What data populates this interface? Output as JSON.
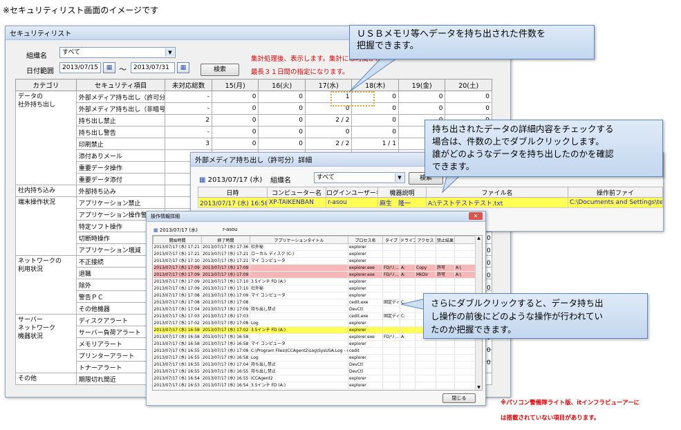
{
  "caption": "※セキュリティリスト画面のイメージです",
  "main_window": {
    "title": "セキュリティリスト",
    "org_label": "組織名",
    "org_value": "すべて",
    "date_label": "日付範囲",
    "date_from": "2013/07/15",
    "date_sep": "～",
    "date_to": "2013/07/31",
    "search_button": "検索",
    "notice_1": "集計処理後、表示します。集計には時間がかかります",
    "notice_2": "最長３１日間の指定になります。",
    "headers": [
      "カテゴリ",
      "セキュリティ項目",
      "未対応総数",
      "15(月)",
      "16(火)",
      "17(水)",
      "18(木)",
      "19(金)",
      "20(土)"
    ],
    "rows": [
      [
        "データの\n社外持ち出し",
        "外部メディア持ち出し（許可分）",
        "-",
        "0",
        "0",
        "1",
        "0",
        "0",
        "0"
      ],
      [
        "",
        "外部メディア持ち出し（非暗号）",
        "-",
        "0",
        "0",
        "0",
        "0",
        "0",
        "0"
      ],
      [
        "",
        "持ち出し禁止",
        "2",
        "0",
        "0",
        "2 / 2",
        "0",
        "0",
        "0"
      ],
      [
        "",
        "持ち出し警告",
        "-",
        "0",
        "0",
        "0",
        "0",
        "0",
        "0"
      ],
      [
        "",
        "印刷禁止",
        "3",
        "0",
        "0",
        "2 / 2",
        "1 / 1",
        "0",
        "0"
      ],
      [
        "",
        "添付ありメール",
        "-",
        "0",
        "1",
        "2",
        "2",
        "",
        ""
      ],
      [
        "",
        "重要データ操作",
        "",
        "",
        "",
        "",
        "",
        "",
        ""
      ],
      [
        "",
        "重要データ添付",
        "",
        "",
        "",
        "",
        "",
        "",
        ""
      ],
      [
        "社内持ち込み",
        "外部持ち込み",
        "",
        "",
        "",
        "",
        "",
        "",
        ""
      ],
      [
        "端末操作状況",
        "アプリケーション禁止",
        "",
        "",
        "",
        "",
        "",
        "",
        ""
      ],
      [
        "",
        "アプリケーション操作警告",
        "",
        "",
        "",
        "",
        "",
        "",
        ""
      ],
      [
        "",
        "特定ソフト操作",
        "",
        "",
        "",
        "",
        "",
        "",
        ""
      ],
      [
        "",
        "切断時操作",
        "",
        "",
        "",
        "",
        "",
        "",
        ""
      ],
      [
        "",
        "アプリケーション増減",
        "",
        "",
        "",
        "",
        "",
        "",
        ""
      ],
      [
        "ネットワークの\n利用状況",
        "不正接続",
        "",
        "",
        "",
        "",
        "",
        "",
        ""
      ],
      [
        "",
        "退職",
        "",
        "",
        "",
        "",
        "",
        "",
        ""
      ],
      [
        "",
        "除外",
        "",
        "",
        "",
        "",
        "",
        "",
        ""
      ],
      [
        "",
        "警告ＰＣ",
        "",
        "",
        "",
        "",
        "",
        "",
        ""
      ],
      [
        "",
        "その他機器",
        "",
        "",
        "",
        "",
        "",
        "",
        ""
      ],
      [
        "サーバー\nネットワーク\n機器状況",
        "ディスクアラート",
        "",
        "",
        "",
        "",
        "",
        "",
        ""
      ],
      [
        "",
        "サーバー負荷アラート",
        "",
        "",
        "",
        "",
        "",
        "",
        ""
      ],
      [
        "",
        "メモリアラート",
        "",
        "",
        "",
        "",
        "",
        "",
        ""
      ],
      [
        "",
        "プリンターアラート",
        "",
        "",
        "",
        "",
        "",
        "",
        ""
      ],
      [
        "",
        "トナーアラート",
        "",
        "",
        "",
        "",
        "",
        "",
        ""
      ],
      [
        "その他",
        "期限切れ間近",
        "",
        "",
        "",
        "",
        "",
        "",
        ""
      ]
    ],
    "right_stub_values": [
      "0",
      "0",
      "0",
      "0",
      "0",
      "0",
      "0",
      "0",
      "0",
      "0",
      "0",
      "0"
    ]
  },
  "detail_window": {
    "title": "外部メディア持ち出し（許可分）詳細",
    "date": "2013/07/17 (水)",
    "org_label": "組織名",
    "org_value": "すべて",
    "search_button": "検索",
    "headers": [
      "日時",
      "コンピューター名",
      "ログインユーザー名",
      "機器説明",
      "ファイル名",
      "操作前ファイ"
    ],
    "row": [
      "2013/07/17 (水) 16:58",
      "XP-TAIKENBAN",
      "r-asou",
      "麻生　隆一",
      "A:\\テストテストテスト.txt",
      "C:\\Documents and Settings\\test\\"
    ]
  },
  "log_window": {
    "title": "操作情報詳細",
    "date": "2013/07/17 (水)",
    "user": "r-asou",
    "headers": [
      "開始時間",
      "終了時間",
      "アプリケーションタイトル",
      "プロセス名",
      "タイプ",
      "ドライブ",
      "アクセス",
      "禁止結果",
      ""
    ],
    "rows": [
      [
        "2013/07/17 (水) 17:21",
        "2013/07/17 (水) 17:36",
        "社外秘",
        "explorer",
        "",
        "",
        "",
        "",
        ""
      ],
      [
        "2013/07/17 (水) 17:21",
        "2013/07/17 (水) 17:21",
        "ローカル ディスク (C:)",
        "explorer",
        "",
        "",
        "",
        "",
        ""
      ],
      [
        "2013/07/17 (水) 17:10",
        "2013/07/17 (水) 17:21",
        "マイ コンピュータ",
        "explorer",
        "",
        "",
        "",
        "",
        ""
      ],
      [
        "2013/07/17 (水) 17:09",
        "2013/07/17 (水) 17:09",
        "",
        "explorer.exe",
        "FD/リ...",
        "A:",
        "Copy",
        "許可",
        "A:\\"
      ],
      [
        "2013/07/17 (水) 17:09",
        "2013/07/17 (水) 17:09",
        "",
        "explorer.exe",
        "FD/リ...",
        "A:",
        "MkDir",
        "許可",
        "A:\\"
      ],
      [
        "2013/07/17 (水) 17:09",
        "2013/07/17 (水) 17:10",
        "3.5インチ FD (A:)",
        "explorer",
        "",
        "",
        "",
        "",
        ""
      ],
      [
        "2013/07/17 (水) 17:09",
        "2013/07/17 (水) 17:10",
        "社外秘",
        "explorer",
        "",
        "",
        "",
        "",
        ""
      ],
      [
        "2013/07/17 (水) 17:08",
        "2013/07/17 (水) 17:09",
        "マイ コンピュータ",
        "explorer",
        "",
        "",
        "",
        "",
        ""
      ],
      [
        "2013/07/17 (水) 17:08",
        "2013/07/17 (水) 17:08",
        "",
        "cedit.exe",
        "固定ディ...",
        "C:",
        "Write",
        "",
        "C:\\Doc"
      ],
      [
        "2013/07/17 (水) 17:04",
        "2013/07/17 (水) 17:09",
        "持ち出し禁止",
        "DevCtl",
        "",
        "",
        "",
        "",
        ""
      ],
      [
        "2013/07/17 (水) 17:03",
        "2013/07/17 (水) 17:03",
        "",
        "cedit.exe",
        "固定ディ...",
        "C:",
        "",
        "",
        ""
      ],
      [
        "2013/07/17 (水) 17:02",
        "2013/07/17 (水) 17:08",
        "Log",
        "explorer",
        "",
        "",
        "",
        "",
        ""
      ],
      [
        "2013/07/17 (水) 16:58",
        "2013/07/17 (水) 17:02",
        "3.5インチ FD (A:)",
        "explorer",
        "",
        "",
        "",
        "",
        ""
      ],
      [
        "2013/07/17 (水) 16:58",
        "2013/07/17 (水) 16:58",
        "",
        "explorer.exe",
        "FD/リ...",
        "A:",
        "",
        "",
        ""
      ],
      [
        "2013/07/17 (水) 16:58",
        "2013/07/17 (水) 16:58",
        "マイ コンピュータ",
        "explorer",
        "",
        "",
        "",
        "",
        ""
      ],
      [
        "2013/07/17 (水) 16:55",
        "2013/07/17 (水) 17:08",
        "C:\\Program Files\\ICCAgent2\\Log\\SysUSA.Log - o...",
        "cedit",
        "",
        "",
        "",
        "",
        ""
      ],
      [
        "2013/07/17 (水) 16:55",
        "2013/07/17 (水) 16:58",
        "Log",
        "explorer",
        "",
        "",
        "",
        "",
        ""
      ],
      [
        "2013/07/17 (水) 16:55",
        "2013/07/17 (水) 17:04",
        "持ち出し禁止",
        "DevCtl",
        "",
        "",
        "",
        "",
        ""
      ],
      [
        "2013/07/17 (水) 16:55",
        "2013/07/17 (水) 16:55",
        "持ち出し禁止",
        "DevCtl",
        "",
        "",
        "",
        "",
        ""
      ],
      [
        "2013/07/17 (水) 16:54",
        "2013/07/17 (水) 16:55",
        "ICCAgent2",
        "explorer",
        "",
        "",
        "",
        "",
        ""
      ],
      [
        "2013/07/17 (水) 16:53",
        "2013/07/17 (水) 16:54",
        "3.5インチ FD (A:)",
        "explorer",
        "",
        "",
        "",
        "",
        ""
      ],
      [
        "2013/07/17 (水) 16:52",
        "2013/07/17 (水) 16:55",
        "持ち出し禁止",
        "DevCtl",
        "",
        "",
        "",
        "",
        ""
      ],
      [
        "2013/07/17 (水) 16:51",
        "2013/07/17 (水) 16:53",
        "マイ コンピュータ",
        "explorer",
        "",
        "",
        "",
        "",
        ""
      ],
      [
        "2013/07/17 (水) 14:54",
        "2013/07/17 (水) 14:55",
        "パソコン管理簿 情報送信",
        "csc",
        "",
        "",
        "",
        "",
        ""
      ]
    ],
    "close_button": "閉じる"
  },
  "callouts": {
    "c1": "ＵＳＢメモリ等へデータを持ち出された件数を\n把握できます。",
    "c2": "持ち出されたデータの詳細内容をチェックする\n場合は、件数の上でダブルクリックします。\n誰がどのようなデータを持ち出したのかを確認\nできます。",
    "c3": "さらにダブルクリックすると、データ持ち出\nし操作の前後にどのような操作が行われてい\nたのか把握できます。"
  },
  "footnote_1": "※パソコン警備隊ライト版、itインフラビューアーに",
  "footnote_2": "は搭載されていない項目があります。",
  "colors": {
    "highlight_yellow": "#ffff55",
    "highlight_pink": "#f5b7b7",
    "notice_red": "#dd0000",
    "callout_border": "#5a86c0",
    "highlight_box": "#f0a030"
  }
}
